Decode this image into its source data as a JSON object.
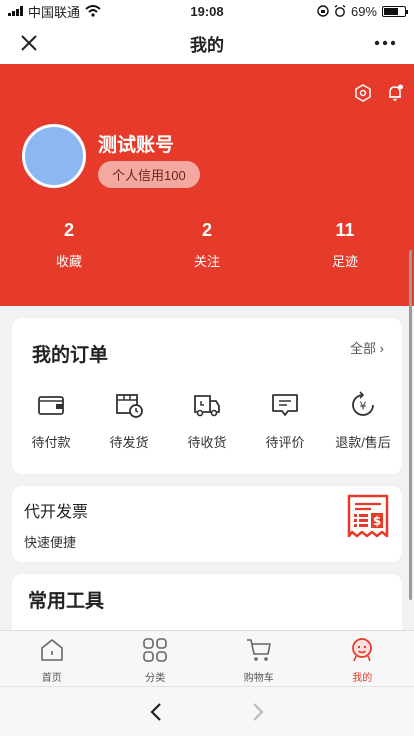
{
  "status_bar": {
    "carrier": "中国联通",
    "time": "19:08",
    "battery": "69%",
    "battery_level": 0.69
  },
  "nav": {
    "title": "我的"
  },
  "profile": {
    "name": "测试账号",
    "credit": "个人信用100",
    "stats": [
      {
        "count": "2",
        "label": "收藏"
      },
      {
        "count": "2",
        "label": "关注"
      },
      {
        "count": "11",
        "label": "足迹"
      }
    ]
  },
  "orders": {
    "title": "我的订单",
    "see_all": "全部",
    "items": [
      {
        "label": "待付款",
        "icon": "wallet-icon"
      },
      {
        "label": "待发货",
        "icon": "package-clock-icon"
      },
      {
        "label": "待收货",
        "icon": "truck-icon"
      },
      {
        "label": "待评价",
        "icon": "comment-icon"
      },
      {
        "label": "退款/售后",
        "icon": "refund-icon"
      }
    ]
  },
  "invoice": {
    "title": "代开发票",
    "subtitle": "快速便捷",
    "icon": "receipt-icon"
  },
  "tools": {
    "title": "常用工具"
  },
  "tabbar": {
    "items": [
      {
        "label": "首页",
        "icon": "home-icon"
      },
      {
        "label": "分类",
        "icon": "grid-icon"
      },
      {
        "label": "购物车",
        "icon": "cart-icon"
      },
      {
        "label": "我的",
        "icon": "user-icon",
        "active": true
      }
    ]
  },
  "colors": {
    "brand": "#e63a2b",
    "avatar": "#8cb8f2",
    "badge": "#f3a99f"
  }
}
